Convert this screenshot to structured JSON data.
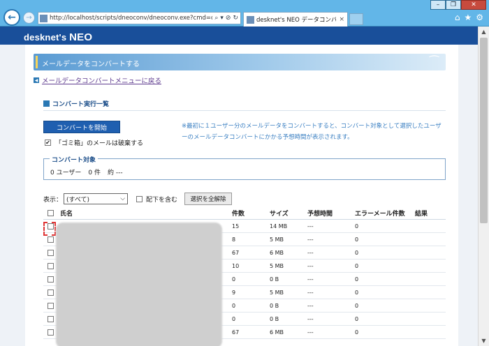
{
  "browser": {
    "address_url": "http://localhost/scripts/dneoconv/dneoconv.exe?cmd=co",
    "address_controls": [
      "⌕",
      "▾",
      "⊘",
      "↻"
    ],
    "tab_title": "desknet's NEO データコンバ...",
    "tab_close": "×",
    "window_controls": [
      "–",
      "❐",
      "✕"
    ],
    "toolbar_icons": [
      "⌂",
      "★",
      "⚙"
    ]
  },
  "app": {
    "logo_prefix": "desknet's ",
    "logo_suffix": "NEO"
  },
  "page": {
    "title": "メールデータをコンバートする",
    "back_link": "メールデータコンバートメニューに戻る",
    "section_title": "コンバート実行一覧",
    "start_button": "コンバートを開始",
    "note": "※最初に１ユーザー分のメールデータをコンバートすると、コンバート対象として選択したユーザーのメールデータコンバートにかかる予想時間が表示されます。",
    "trash_option": {
      "checked": true,
      "label": "「ゴミ箱」のメールは破棄する"
    },
    "target": {
      "legend": "コンバート対象",
      "users": "0 ユーザー",
      "count": "0 件",
      "approx": "約 ---"
    },
    "filter": {
      "label": "表示：",
      "selected": "(すべて)",
      "include_sub_label": "配下を含む",
      "clear_button": "選択を全解除"
    }
  },
  "table": {
    "headers": {
      "name": "氏名",
      "count": "件数",
      "size": "サイズ",
      "time": "予想時間",
      "errors": "エラーメール件数",
      "result": "結果"
    },
    "rows": [
      {
        "count": "15",
        "size": "14 MB",
        "time": "---",
        "errors": "0",
        "result": ""
      },
      {
        "count": "8",
        "size": "5 MB",
        "time": "---",
        "errors": "0",
        "result": ""
      },
      {
        "count": "67",
        "size": "6 MB",
        "time": "---",
        "errors": "0",
        "result": ""
      },
      {
        "count": "10",
        "size": "5 MB",
        "time": "---",
        "errors": "0",
        "result": ""
      },
      {
        "count": "0",
        "size": "0 B",
        "time": "---",
        "errors": "0",
        "result": ""
      },
      {
        "count": "9",
        "size": "5 MB",
        "time": "---",
        "errors": "0",
        "result": ""
      },
      {
        "count": "0",
        "size": "0 B",
        "time": "---",
        "errors": "0",
        "result": ""
      },
      {
        "count": "0",
        "size": "0 B",
        "time": "---",
        "errors": "0",
        "result": ""
      },
      {
        "count": "67",
        "size": "6 MB",
        "time": "---",
        "errors": "0",
        "result": ""
      }
    ]
  },
  "colors": {
    "header_bg": "#194f9a",
    "chrome_bg": "#62b6e8",
    "accent": "#1f5fb0",
    "note_text": "#3a7fc2",
    "highlight": "#e03535"
  }
}
